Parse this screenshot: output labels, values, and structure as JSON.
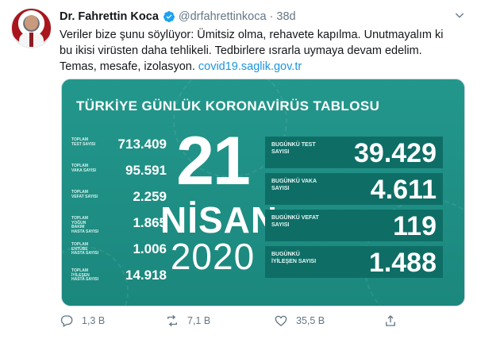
{
  "tweet": {
    "author_name": "Dr. Fahrettin Koca",
    "handle": "@drfahrettinkoca",
    "separator": "·",
    "time": "38d",
    "text_lines": [
      "Veriler bize şunu söylüyor: Ümitsiz olma, rehavete kapılma. Unutmayalım ki",
      "bu ikisi virüsten daha tehlikeli. Tedbirlere ısrarla uymaya devam edelim.",
      "Temas, mesafe, izolasyon."
    ],
    "link_text": "covid19.saglik.gov.tr"
  },
  "card": {
    "title": "TÜRKİYE GÜNLÜK KORONAVİRÜS TABLOSU",
    "day": "21",
    "month": "NİSAN",
    "year": "2020",
    "left_stats": [
      {
        "label": "TOPLAM TEST SAYISI",
        "value": "713.409"
      },
      {
        "label": "TOPLAM VAKA SAYISI",
        "value": "95.591"
      },
      {
        "label": "TOPLAM VEFAT SAYISI",
        "value": "2.259"
      },
      {
        "label": "TOPLAM YOĞUN BAKIM HASTA SAYISI",
        "value": "1.865"
      },
      {
        "label": "TOPLAM ENTÜBE HASTA SAYISI",
        "value": "1.006"
      },
      {
        "label": "TOPLAM İYİLEŞEN HASTA SAYISI",
        "value": "14.918"
      }
    ],
    "right_stats": [
      {
        "label": "BUGÜNKÜ TEST SAYISI",
        "value": "39.429"
      },
      {
        "label": "BUGÜNKÜ VAKA SAYISI",
        "value": "4.611"
      },
      {
        "label": "BUGÜNKÜ VEFAT SAYISI",
        "value": "119"
      },
      {
        "label": "BUGÜNKÜ İYİLEŞEN SAYISI",
        "value": "1.488"
      }
    ]
  },
  "actions": {
    "reply_count": "1,3 B",
    "retweet_count": "7,1 B",
    "like_count": "35,5 B"
  },
  "colors": {
    "card_bg": "#1d8c82",
    "stat_box": "#0e6e66",
    "link": "#1b95e0",
    "verified": "#1da1f2"
  },
  "icons": [
    "verified-badge-icon",
    "caret-down-icon",
    "reply-icon",
    "retweet-icon",
    "like-icon",
    "share-icon"
  ]
}
